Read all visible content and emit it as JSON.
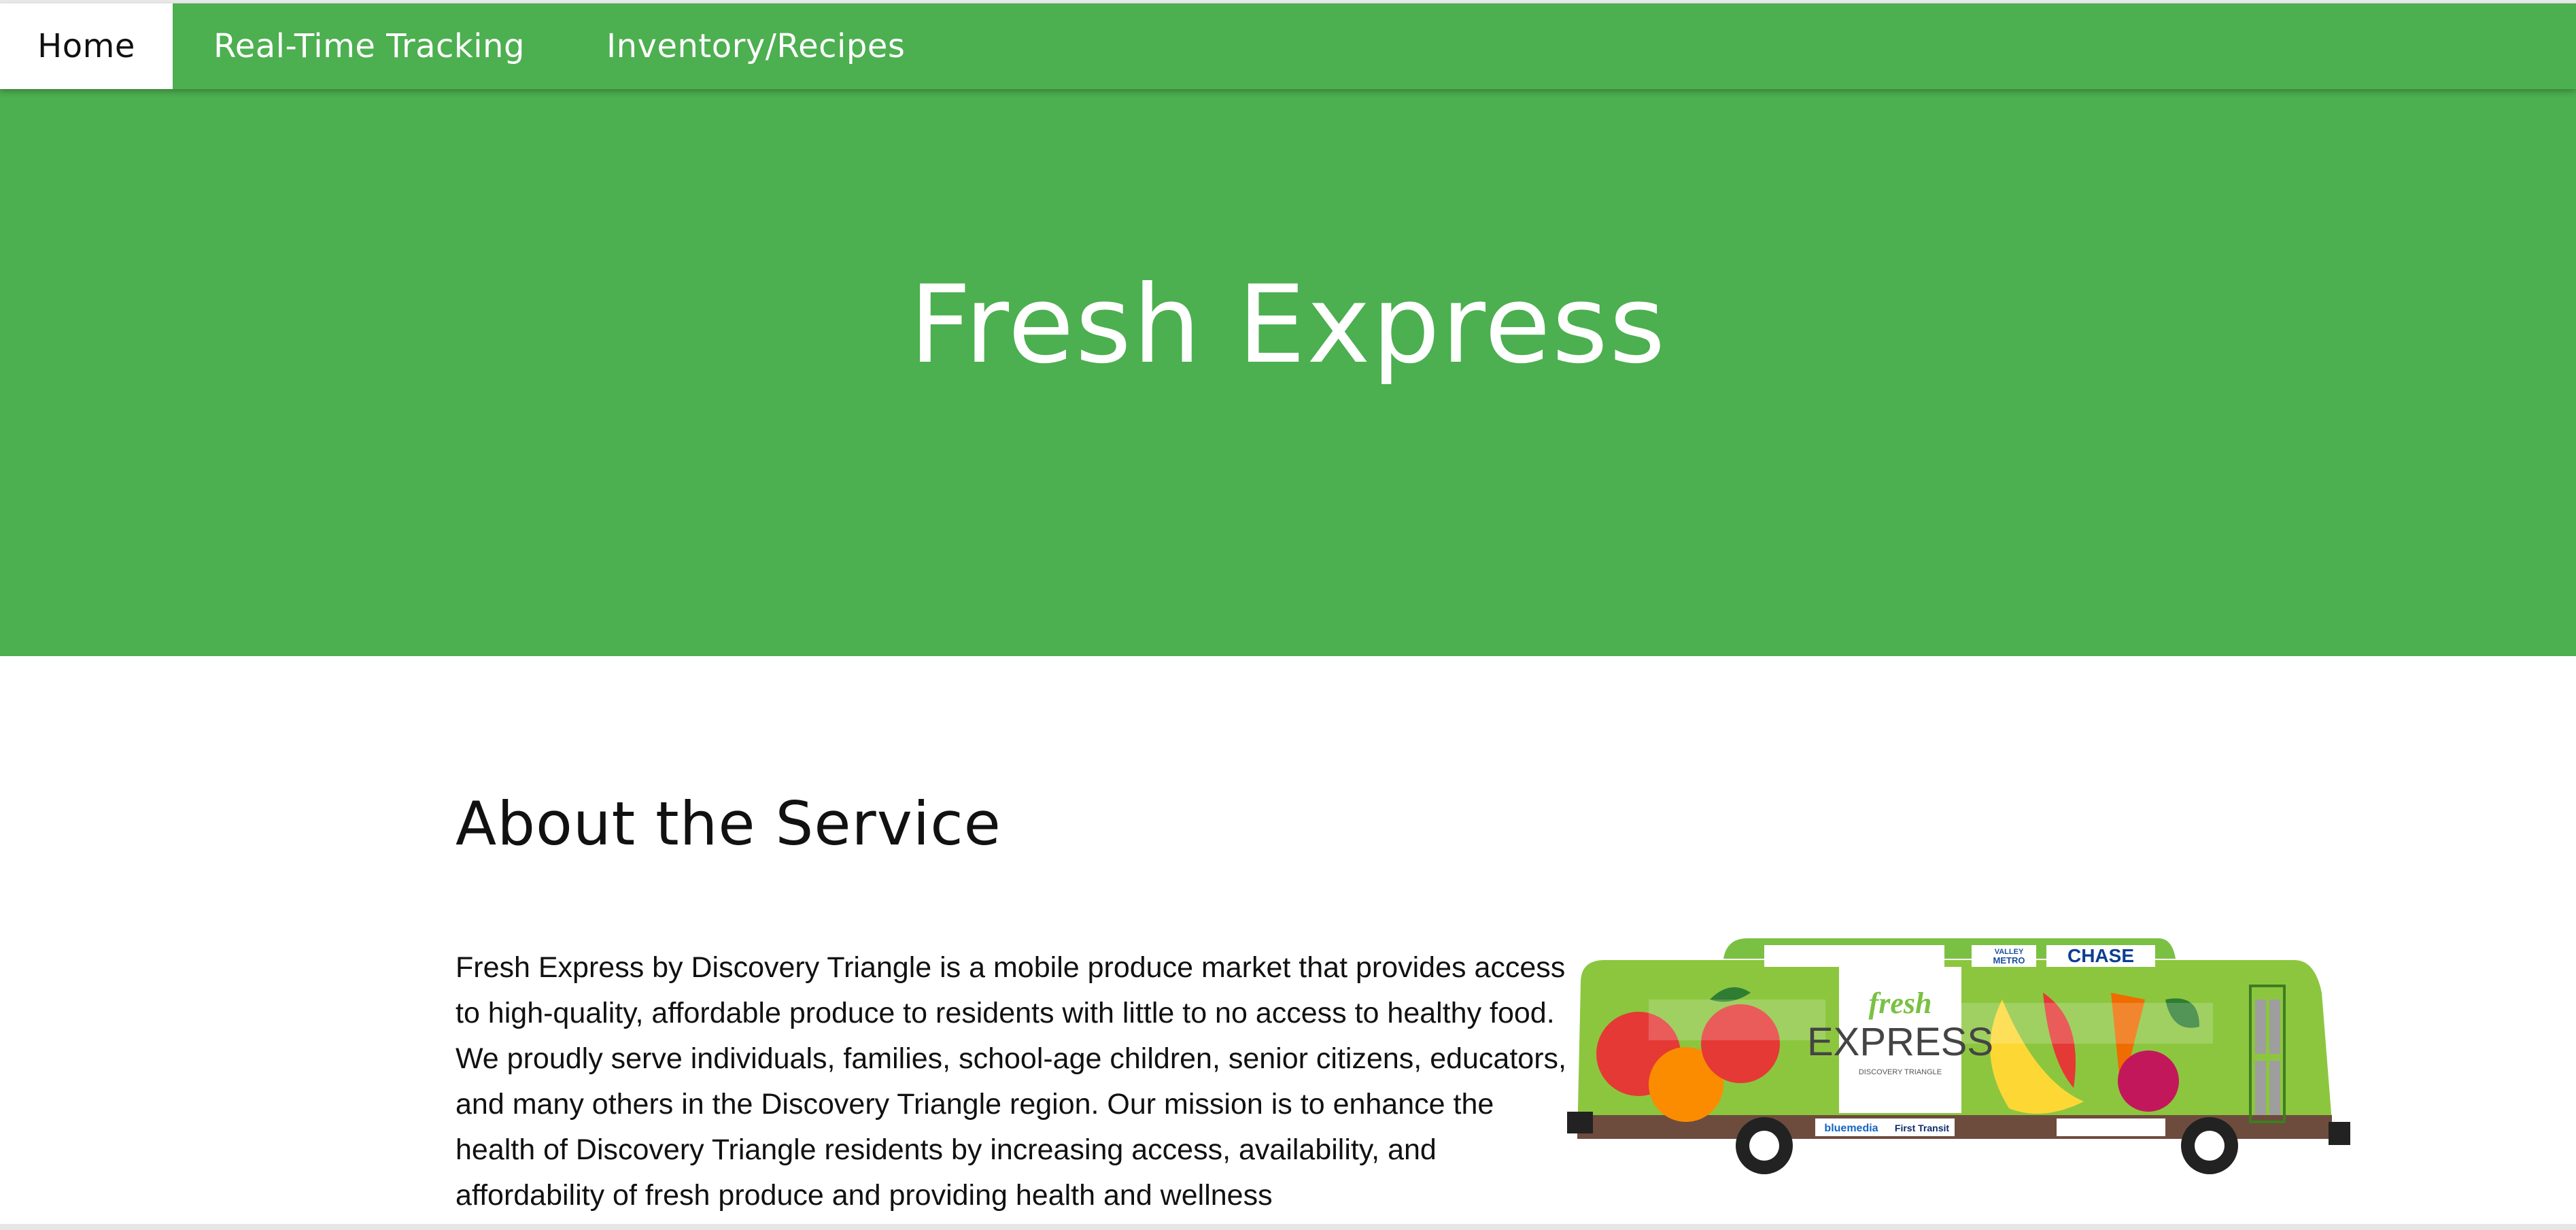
{
  "nav": {
    "items": [
      {
        "label": "Home",
        "active": true
      },
      {
        "label": "Real-Time Tracking",
        "active": false
      },
      {
        "label": "Inventory/Recipes",
        "active": false
      }
    ]
  },
  "hero": {
    "title": "Fresh Express",
    "background_color": "#4caf50"
  },
  "about": {
    "heading": "About the Service",
    "paragraph": "Fresh Express by Discovery Triangle is a mobile produce market that provides access to high-quality, affordable produce to residents with little to no access to healthy food. We proudly serve individuals, families, school-age children, senior citizens, educators, and many others in the Discovery Triangle region. Our mission is to enhance the health of Discovery Triangle residents by increasing access, availability, and affordability of fresh produce and providing health and wellness"
  },
  "bus_image": {
    "logo_top": "fresh",
    "logo_main": "EXPRESS",
    "logo_sub": "DISCOVERY TRIANGLE",
    "sponsor_chase": "CHASE",
    "sponsor_metro_line1": "VALLEY",
    "sponsor_metro_line2": "METRO",
    "sponsor_bluemedia": "bluemedia",
    "sponsor_firsttransit": "First Transit"
  }
}
